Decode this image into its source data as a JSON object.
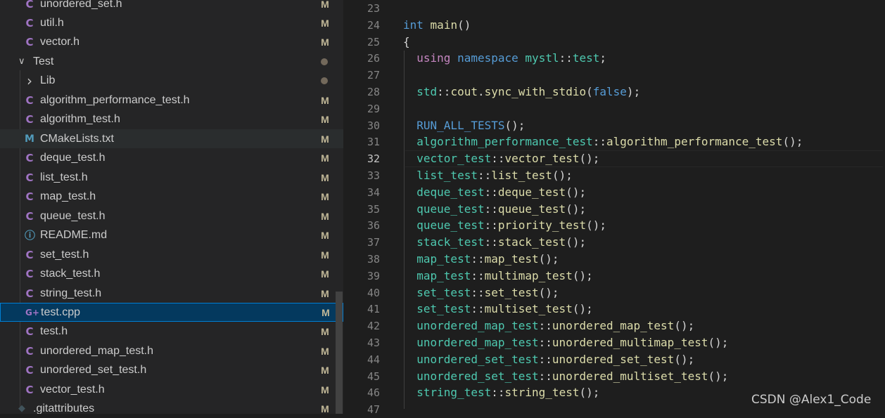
{
  "explorer": {
    "items": [
      {
        "label": "unordered_set.h",
        "status": "M",
        "icon": "c-file-icon",
        "kind": "file"
      },
      {
        "label": "util.h",
        "status": "M",
        "icon": "c-file-icon",
        "kind": "file"
      },
      {
        "label": "vector.h",
        "status": "M",
        "icon": "c-file-icon",
        "kind": "file"
      },
      {
        "label": "Test",
        "status": "dot",
        "icon": "chevron-down-icon",
        "kind": "folder-open"
      },
      {
        "label": "Lib",
        "status": "dot",
        "icon": "chevron-right-icon",
        "kind": "folder-closed"
      },
      {
        "label": "algorithm_performance_test.h",
        "status": "M",
        "icon": "c-file-icon",
        "kind": "file"
      },
      {
        "label": "algorithm_test.h",
        "status": "M",
        "icon": "c-file-icon",
        "kind": "file"
      },
      {
        "label": "CMakeLists.txt",
        "status": "M",
        "icon": "cmake-file-icon",
        "kind": "file"
      },
      {
        "label": "deque_test.h",
        "status": "M",
        "icon": "c-file-icon",
        "kind": "file"
      },
      {
        "label": "list_test.h",
        "status": "M",
        "icon": "c-file-icon",
        "kind": "file"
      },
      {
        "label": "map_test.h",
        "status": "M",
        "icon": "c-file-icon",
        "kind": "file"
      },
      {
        "label": "queue_test.h",
        "status": "M",
        "icon": "c-file-icon",
        "kind": "file"
      },
      {
        "label": "README.md",
        "status": "M",
        "icon": "info-file-icon",
        "kind": "file"
      },
      {
        "label": "set_test.h",
        "status": "M",
        "icon": "c-file-icon",
        "kind": "file"
      },
      {
        "label": "stack_test.h",
        "status": "M",
        "icon": "c-file-icon",
        "kind": "file"
      },
      {
        "label": "string_test.h",
        "status": "M",
        "icon": "c-file-icon",
        "kind": "file"
      },
      {
        "label": "test.cpp",
        "status": "M",
        "icon": "cpp-file-icon",
        "kind": "file"
      },
      {
        "label": "test.h",
        "status": "M",
        "icon": "c-file-icon",
        "kind": "file"
      },
      {
        "label": "unordered_map_test.h",
        "status": "M",
        "icon": "c-file-icon",
        "kind": "file"
      },
      {
        "label": "unordered_set_test.h",
        "status": "M",
        "icon": "c-file-icon",
        "kind": "file"
      },
      {
        "label": "vector_test.h",
        "status": "M",
        "icon": "c-file-icon",
        "kind": "file"
      },
      {
        "label": ".gitattributes",
        "status": "M",
        "icon": "git-file-icon",
        "kind": "file"
      }
    ],
    "selected": "test.cpp",
    "hovered": "CMakeLists.txt"
  },
  "editor": {
    "active_line": "32",
    "lines": [
      {
        "num": "23",
        "code": ""
      },
      {
        "num": "24",
        "code": "int main()"
      },
      {
        "num": "25",
        "code": "{"
      },
      {
        "num": "26",
        "code": "  using namespace mystl::test;"
      },
      {
        "num": "27",
        "code": ""
      },
      {
        "num": "28",
        "code": "  std::cout.sync_with_stdio(false);"
      },
      {
        "num": "29",
        "code": ""
      },
      {
        "num": "30",
        "code": "  RUN_ALL_TESTS();"
      },
      {
        "num": "31",
        "code": "  algorithm_performance_test::algorithm_performance_test();"
      },
      {
        "num": "32",
        "code": "  vector_test::vector_test();"
      },
      {
        "num": "33",
        "code": "  list_test::list_test();"
      },
      {
        "num": "34",
        "code": "  deque_test::deque_test();"
      },
      {
        "num": "35",
        "code": "  queue_test::queue_test();"
      },
      {
        "num": "36",
        "code": "  queue_test::priority_test();"
      },
      {
        "num": "37",
        "code": "  stack_test::stack_test();"
      },
      {
        "num": "38",
        "code": "  map_test::map_test();"
      },
      {
        "num": "39",
        "code": "  map_test::multimap_test();"
      },
      {
        "num": "40",
        "code": "  set_test::set_test();"
      },
      {
        "num": "41",
        "code": "  set_test::multiset_test();"
      },
      {
        "num": "42",
        "code": "  unordered_map_test::unordered_map_test();"
      },
      {
        "num": "43",
        "code": "  unordered_map_test::unordered_multimap_test();"
      },
      {
        "num": "44",
        "code": "  unordered_set_test::unordered_set_test();"
      },
      {
        "num": "45",
        "code": "  unordered_set_test::unordered_multiset_test();"
      },
      {
        "num": "46",
        "code": "  string_test::string_test();"
      },
      {
        "num": "47",
        "code": ""
      }
    ]
  },
  "watermark": "CSDN @Alex1_Code",
  "colors": {
    "sidebar_bg": "#252526",
    "editor_bg": "#1e1e1e",
    "selection_bg": "#04395e",
    "selection_border": "#007fd4",
    "keyword": "#569cd6",
    "control_keyword": "#c586c0",
    "namespace": "#4ec9b0",
    "function": "#dcdcaa",
    "modified_badge": "#c0b797"
  }
}
